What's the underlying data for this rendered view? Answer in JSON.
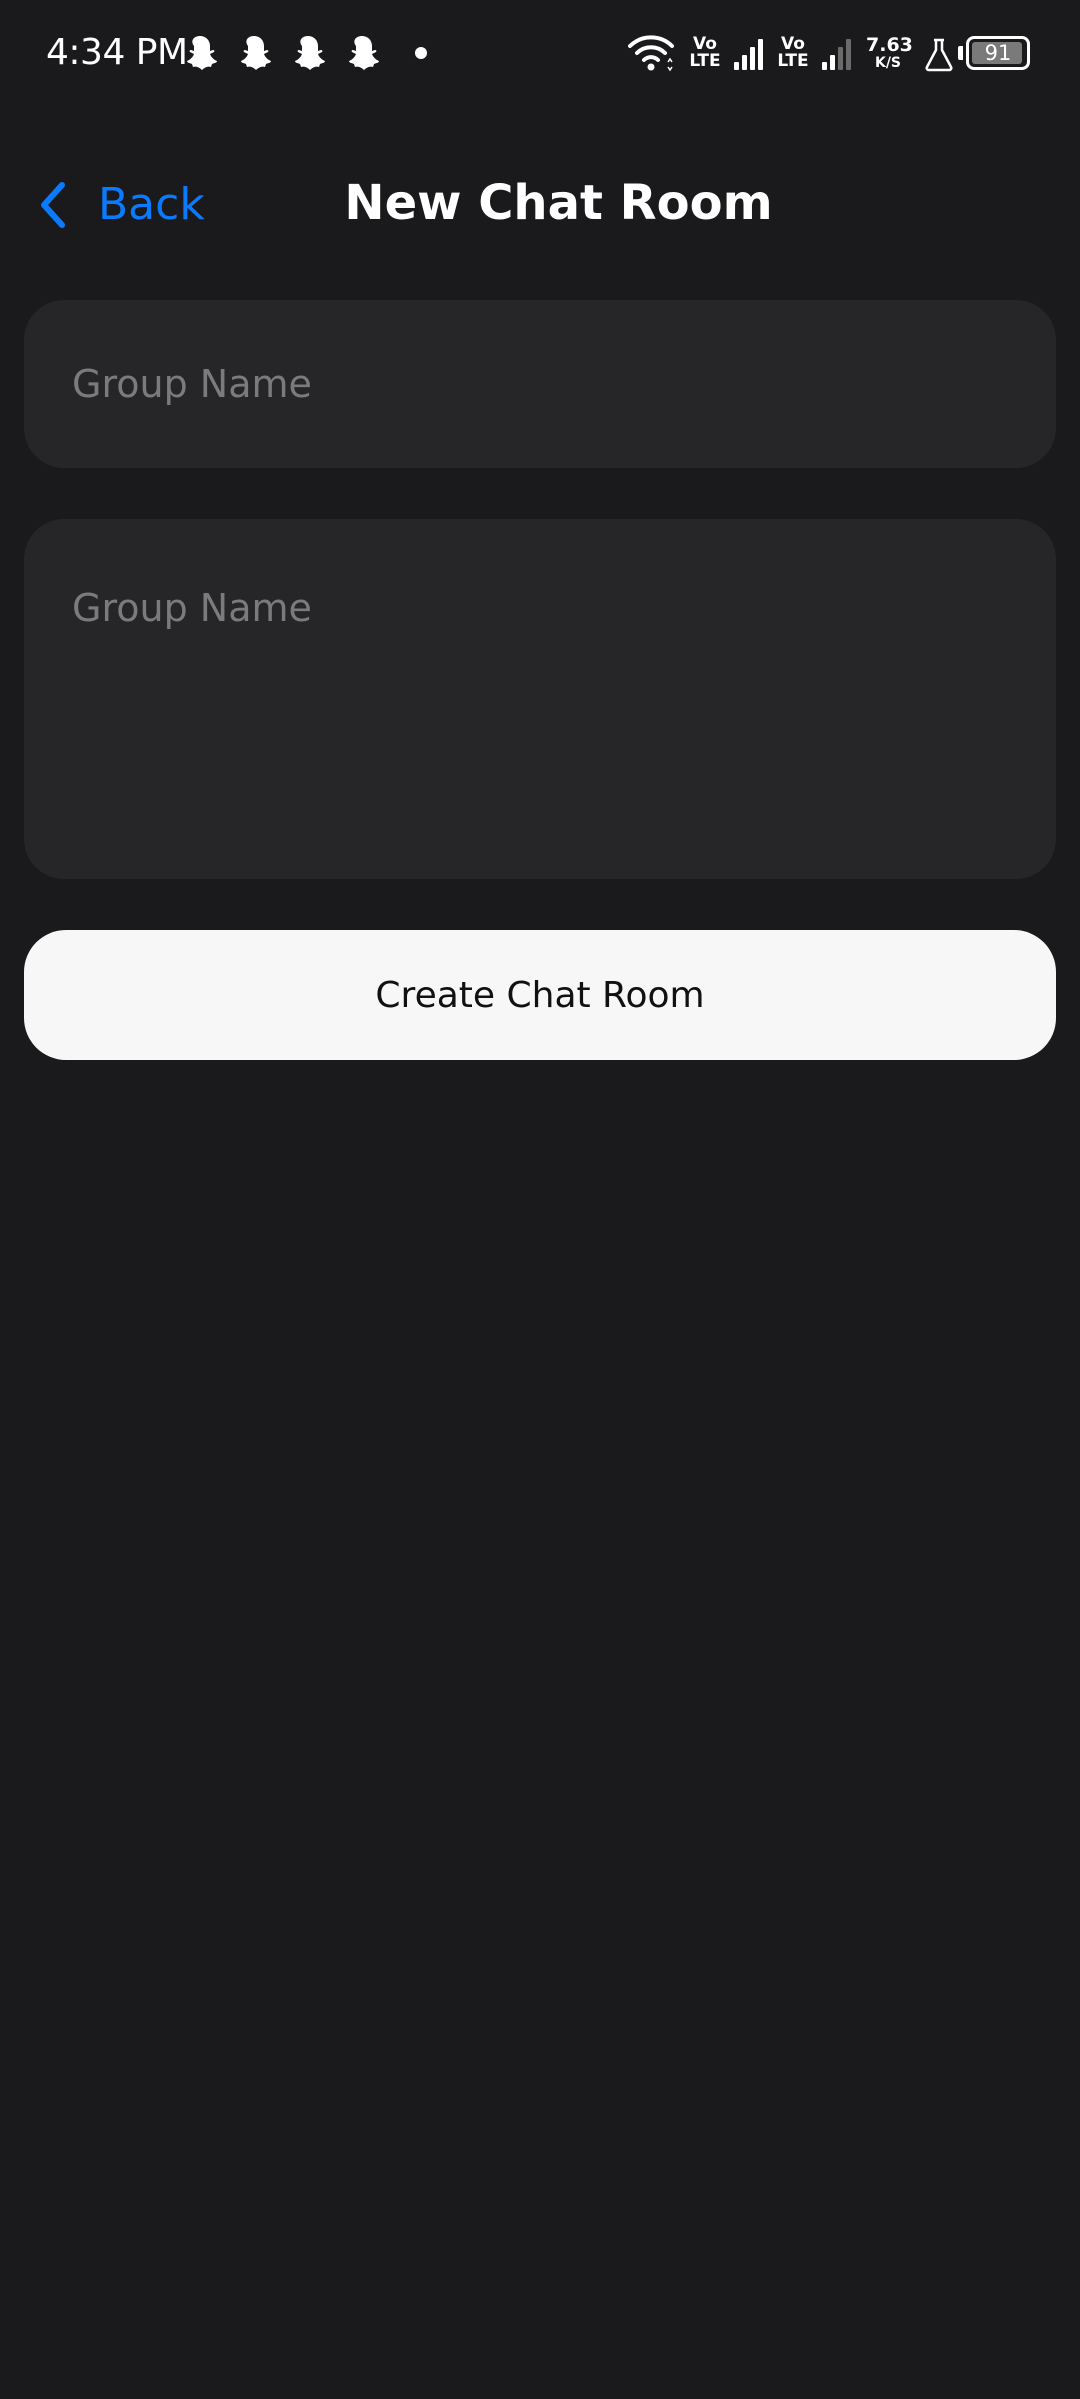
{
  "status_bar": {
    "time": "4:34 PM",
    "volte_1": "Vo\nLTE",
    "volte_2": "Vo\nLTE",
    "net_speed_value": "7.63",
    "net_speed_unit": "K/S",
    "battery": "91",
    "icons": [
      "snapchat-icon",
      "snapchat-icon",
      "snapchat-icon",
      "snapchat-icon",
      "notification-dot",
      "wifi-icon",
      "signal-icon",
      "signal-icon",
      "flask-icon",
      "battery-icon"
    ]
  },
  "header": {
    "back_label": "Back",
    "title": "New Chat Room"
  },
  "form": {
    "group_name_placeholder": "Group Name",
    "description_placeholder": "Group Name",
    "submit_label": "Create Chat Room"
  },
  "colors": {
    "background": "#1a1a1c",
    "field": "#262628",
    "accent": "#0a7aff",
    "button": "#f7f7f7"
  }
}
